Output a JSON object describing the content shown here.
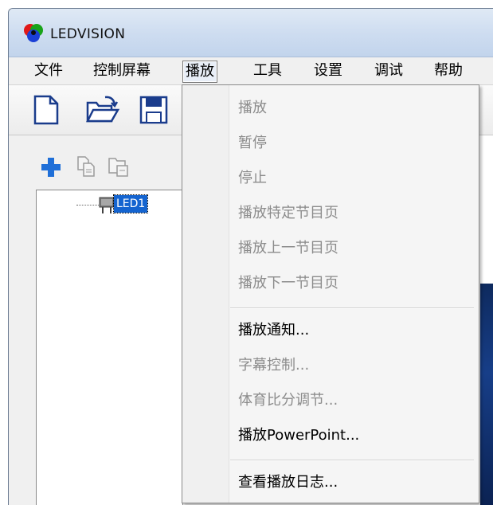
{
  "app": {
    "title": "LEDVISION",
    "logo_icon": "ledvision-logo-icon"
  },
  "menubar": {
    "items": [
      {
        "label": "文件"
      },
      {
        "label": "控制屏幕"
      },
      {
        "label": "播放",
        "active": true
      },
      {
        "label": "工具"
      },
      {
        "label": "设置"
      },
      {
        "label": "调试"
      },
      {
        "label": "帮助"
      }
    ]
  },
  "toolbar": {
    "icons": [
      "new-document-icon",
      "open-folder-icon",
      "save-icon"
    ]
  },
  "left_panel": {
    "mini_toolbar_icons": [
      "add-icon",
      "copy-icon",
      "paste-icon"
    ],
    "tree": {
      "node": {
        "label": "LED1",
        "icon": "led-screen-icon"
      }
    }
  },
  "dropdown": {
    "items": [
      {
        "label": "播放",
        "enabled": false
      },
      {
        "label": "暂停",
        "enabled": false
      },
      {
        "label": "停止",
        "enabled": false
      },
      {
        "label": "播放特定节目页",
        "enabled": false
      },
      {
        "label": "播放上一节目页",
        "enabled": false
      },
      {
        "label": "播放下一节目页",
        "enabled": false
      },
      {
        "label": "播放通知...",
        "enabled": true
      },
      {
        "label": "字幕控制...",
        "enabled": false
      },
      {
        "label": "体育比分调节...",
        "enabled": false
      },
      {
        "label": "播放PowerPoint...",
        "enabled": true
      },
      {
        "label": "查看播放日志...",
        "enabled": true
      }
    ]
  },
  "colors": {
    "accent_blue": "#1464d0",
    "disabled_text": "#8c8c8c",
    "plus_blue": "#1f6fd8"
  }
}
